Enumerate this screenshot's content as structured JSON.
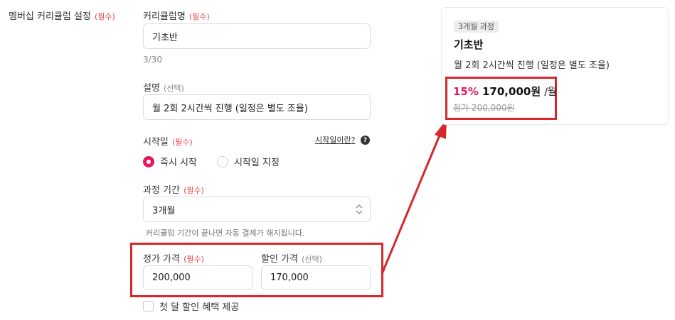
{
  "section": {
    "title": "멤버십 커리큘럼 설정",
    "required": "(필수)"
  },
  "curriculum_name": {
    "label": "커리큘럼명",
    "required": "(필수)",
    "value": "기초반",
    "counter": "3/30"
  },
  "description": {
    "label": "설명",
    "optional": "(선택)",
    "value": "월 2회 2시간씩 진행 (일정은 별도 조율)"
  },
  "start_date": {
    "label": "시작일",
    "required": "(필수)",
    "help_link": "시작일이란?",
    "options": [
      {
        "label": "즉시 시작",
        "selected": true
      },
      {
        "label": "시작일 지정",
        "selected": false
      }
    ]
  },
  "duration": {
    "label": "과정 기간",
    "required": "(필수)",
    "value": "3개월",
    "helper": "커리큘럼 기간이 끝나면 자동 결제가 해지됩니다."
  },
  "pricing": {
    "regular": {
      "label": "정가 가격",
      "required": "(필수)",
      "value": "200,000"
    },
    "discount": {
      "label": "할인 가격",
      "optional": "(선택)",
      "value": "170,000"
    }
  },
  "first_month": {
    "label": "첫 달 할인 혜택 제공",
    "checked": false
  },
  "preview": {
    "badge": "3개월 과정",
    "title": "기초반",
    "description": "월 2회 2시간씩 진행 (일정은 별도 조율)",
    "discount_pct": "15%",
    "price": "170,000원",
    "per": "/월",
    "original": "정가 200,000원"
  },
  "colors": {
    "accent": "#e8175d",
    "highlight_box": "#d5282a",
    "required": "#e0454e"
  }
}
